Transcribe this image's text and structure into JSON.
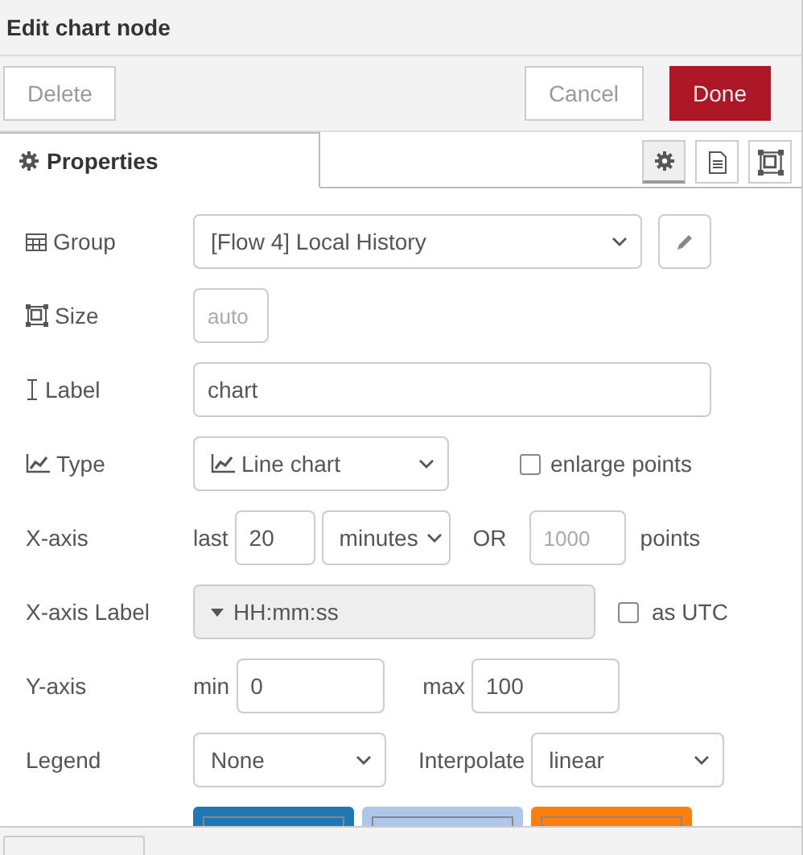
{
  "title": "Edit chart node",
  "buttons": [
    {
      "label": "Delete",
      "kind": "plain"
    },
    {
      "label": "Cancel",
      "kind": "plain"
    },
    {
      "label": "Done",
      "kind": "primary"
    }
  ],
  "tab": {
    "label": "Properties",
    "selected": true
  },
  "side_tabs": [
    {
      "kind": "gear",
      "selected": true
    },
    {
      "kind": "doc",
      "selected": false
    },
    {
      "kind": "frame",
      "selected": false
    }
  ],
  "form": {
    "group": {
      "label": "Group",
      "value": "[Flow 4] Local History"
    },
    "size": {
      "label": "Size",
      "value": "auto"
    },
    "name": {
      "label": "Label",
      "value": "chart"
    },
    "type": {
      "label": "Type",
      "value": "Line chart",
      "enlarge_label": "enlarge points",
      "enlarge_checked": false
    },
    "x_axis": {
      "label": "X-axis",
      "last": "last",
      "amount": "20",
      "unit": "minutes",
      "or": "OR",
      "points_placeholder": "1000",
      "points": "points"
    },
    "x_axis_label": {
      "label": "X-axis Label",
      "value": "HH:mm:ss",
      "utc_label": "as UTC",
      "utc_checked": false
    },
    "y_axis": {
      "label": "Y-axis",
      "min_label": "min",
      "min": "0",
      "max_label": "max",
      "max": "100"
    },
    "legend": {
      "label": "Legend",
      "value": "None",
      "interpolate_label": "Interpolate",
      "interpolate": "linear"
    },
    "series_colours": [
      {
        "color": "#1f77b4"
      },
      {
        "color": "#aec7e8"
      },
      {
        "color": "#ff7f0e"
      }
    ]
  }
}
